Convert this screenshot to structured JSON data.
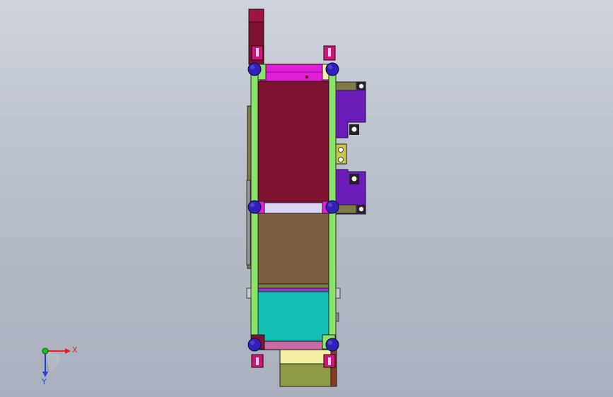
{
  "viewport": {
    "background_top": "#cfd4dc",
    "background_bottom": "#a9b0bd"
  },
  "model": {
    "colors": {
      "maroon": "#7d1230",
      "brown": "#78603f",
      "cyan": "#12bfb3",
      "frame_green": "#8be36b",
      "magenta": "#e01ed8",
      "purple": "#6a1bb8",
      "olive": "#7e7a45",
      "olive_light": "#8e9a46",
      "lavender": "#d9d4f5",
      "pink": "#c76aa6",
      "pale_yellow": "#f3f0a5",
      "bolt_blue": "#3020b8"
    }
  },
  "triad": {
    "x_label": "X",
    "y_label": "Y",
    "x_color": "#e02020",
    "y_color": "#2040e0",
    "origin_color": "#20c020"
  }
}
